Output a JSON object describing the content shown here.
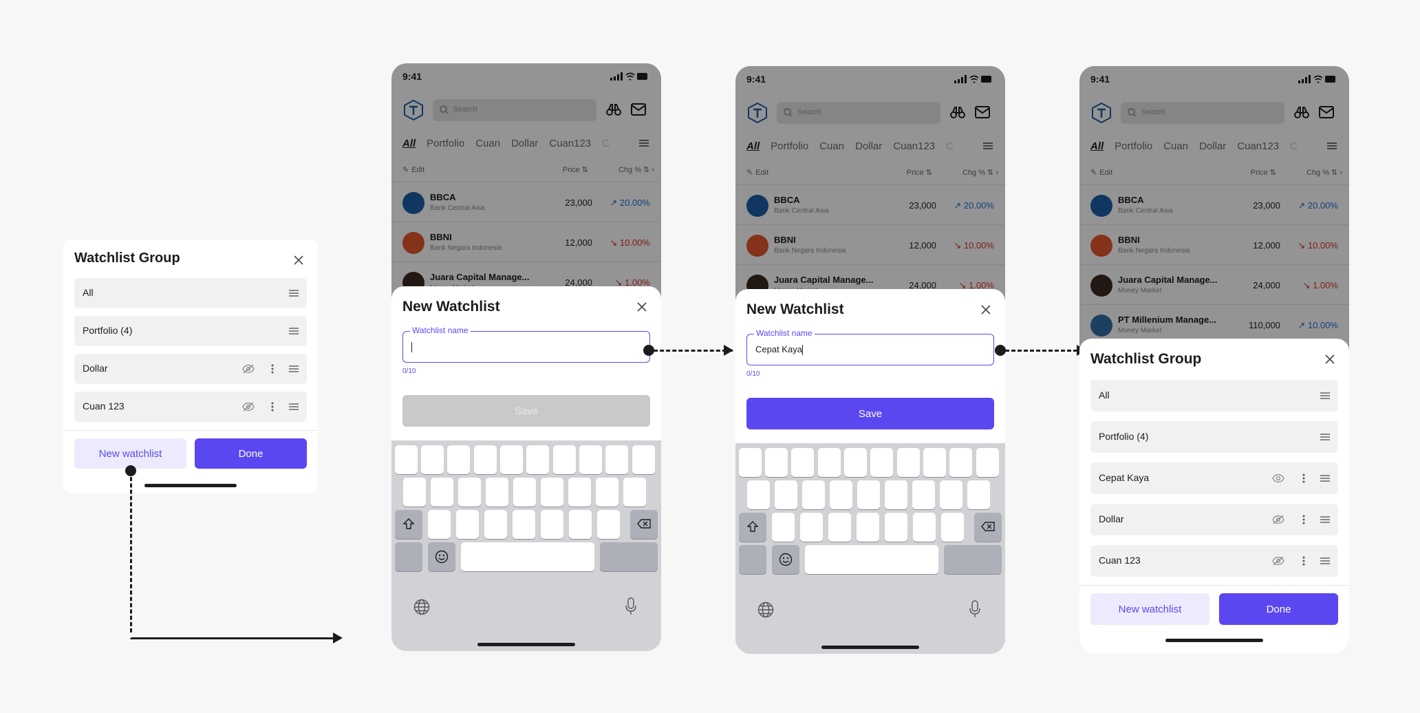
{
  "status_time": "9:41",
  "search_placeholder": "Search",
  "tabs": [
    "All",
    "Portfolio",
    "Cuan",
    "Dollar",
    "Cuan123",
    "C"
  ],
  "list_header": {
    "edit": "Edit",
    "price": "Price",
    "chg": "Chg %"
  },
  "stocks": [
    {
      "code": "BBCA",
      "name": "Bank Central Asia",
      "price": "23,000",
      "chg": "↗ 20.00%",
      "dir": "up",
      "color": "#1b5fa8"
    },
    {
      "code": "BBNI",
      "name": "Bank Negara Indonesia",
      "price": "12,000",
      "chg": "↘ 10.00%",
      "dir": "dn",
      "color": "#e4572e"
    },
    {
      "code": "Juara Capital Manage...",
      "name": "Money Market",
      "price": "24,000",
      "chg": "↘ 1.00%",
      "dir": "dn",
      "color": "#3a2a22"
    },
    {
      "code": "PT Millenium Manage...",
      "name": "Money Market",
      "price": "110,000",
      "chg": "↗ 10.00%",
      "dir": "up",
      "color": "#2f6fa8"
    }
  ],
  "group_card": {
    "title": "Watchlist Group",
    "items": [
      "All",
      "Portfolio (4)",
      "Dollar",
      "Cuan 123"
    ],
    "new_btn": "New watchlist",
    "done_btn": "Done"
  },
  "new_watchlist_empty": {
    "title": "New Watchlist",
    "field_label": "Watchlist name",
    "value": "",
    "counter": "0/10",
    "save": "Save"
  },
  "new_watchlist_filled": {
    "title": "New Watchlist",
    "field_label": "Watchlist name",
    "value": "Cepat Kaya",
    "counter": "0/10",
    "save": "Save"
  },
  "group_sheet": {
    "title": "Watchlist Group",
    "items": [
      "All",
      "Portfolio (4)",
      "Cepat Kaya",
      "Dollar",
      "Cuan 123"
    ],
    "new_btn": "New watchlist",
    "done_btn": "Done"
  },
  "colors": {
    "accent": "#5b47f0",
    "accent_light": "#ecebfd",
    "up": "#1f6fd1",
    "down": "#d93025"
  }
}
